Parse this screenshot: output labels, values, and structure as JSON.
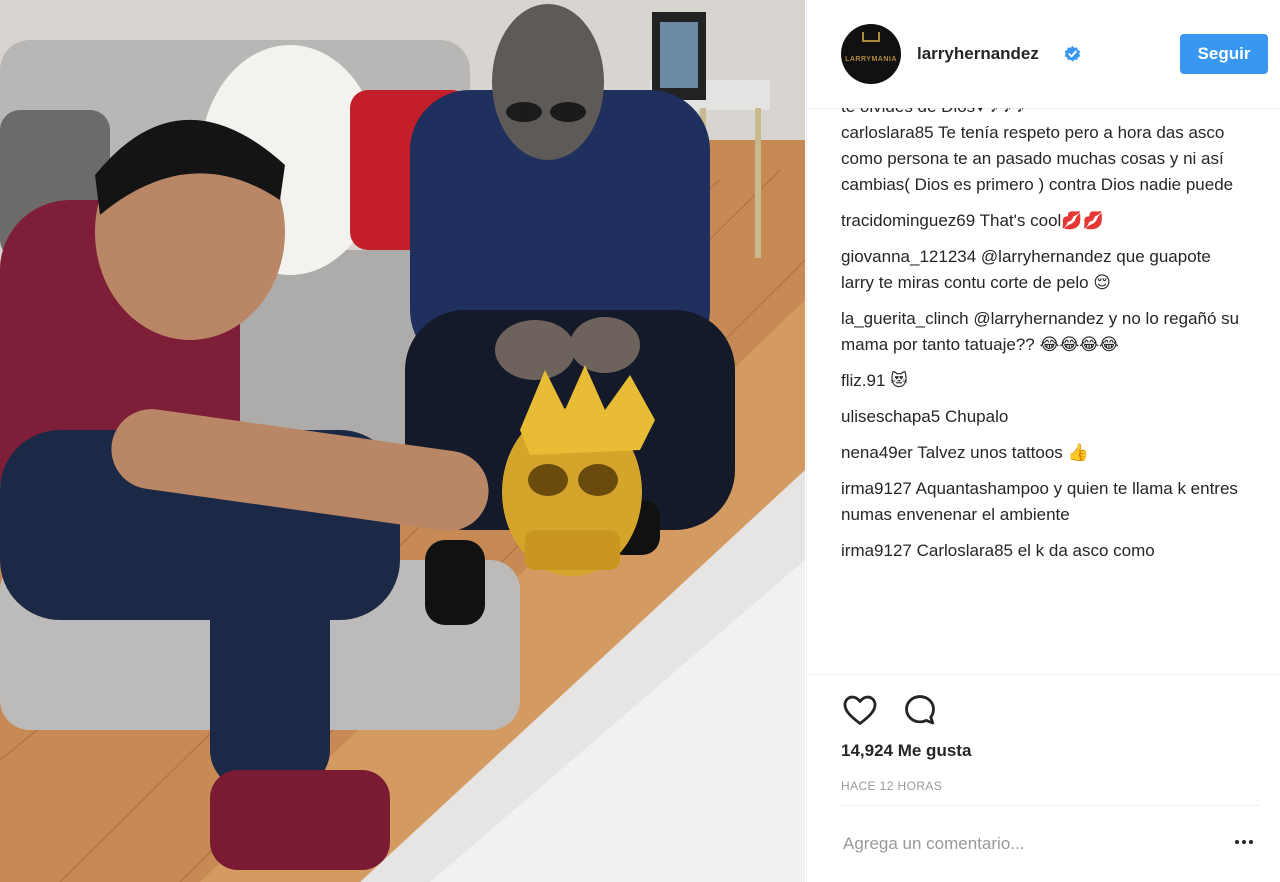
{
  "post": {
    "author": "larryhernandez",
    "verified_badge": "verified-badge-icon",
    "avatar_brand": "LARRYMANIA",
    "follow_label": "Seguir",
    "likes": "14,924 Me gusta",
    "time_ago": "HACE 12 HORAS",
    "add_comment_placeholder": "Agrega un comentario..."
  },
  "comments_cut_top": "te olvides de Dios♥ ♪ ♪ ♪",
  "comments": [
    {
      "user": "carloslara85",
      "text": "Te tenía respeto pero a hora das asco como persona te an pasado muchas cosas y ni así cambias( Dios es primero ) contra Dios nadie puede"
    },
    {
      "user": "tracidominguez69",
      "text": "That's cool💋💋"
    },
    {
      "user": "giovanna_121234",
      "text": "@larryhernandez que guapote larry te miras contu corte de pelo 😌"
    },
    {
      "user": "la_guerita_clinch",
      "text": "@larryhernandez y no lo regañó su mama por tanto tatuaje?? 😂😂😂😂"
    },
    {
      "user": "fliz.91",
      "text": "😻"
    },
    {
      "user": "uliseschapa5",
      "text": "Chupalo"
    },
    {
      "user": "nena49er",
      "text": "Talvez unos tattoos 👍"
    },
    {
      "user": "irma9127",
      "text": "Aquantashampoo y quien te llama k entres numas envenenar el ambiente"
    }
  ],
  "comments_cut_bottom": "irma9127 Carloslara85 el k da asco como",
  "icons": {
    "like": "heart-icon",
    "comment": "comment-icon",
    "more": "more-options-icon"
  },
  "colors": {
    "follow_button": "#3897f0",
    "verified": "#3897f0",
    "muted_text": "#999999"
  }
}
